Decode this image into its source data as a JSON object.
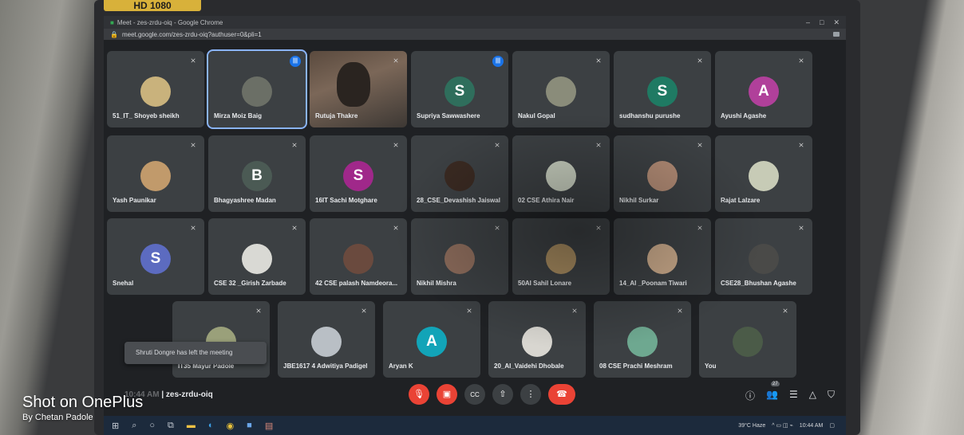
{
  "sticker": "HD 1080",
  "browser": {
    "title": "Meet - zes-zrdu-oiq - Google Chrome",
    "url": "meet.google.com/zes-zrdu-oiq?authuser=0&pli=1"
  },
  "tiles": [
    {
      "name": "51_IT_ Shoyeb sheikh",
      "avatar": "",
      "color": "#c9b27c",
      "mic": "muted"
    },
    {
      "name": "Mirza Moiz Baig",
      "avatar": "",
      "color": "#6b6f66",
      "mic": "speaking",
      "active": true
    },
    {
      "name": "Rutuja Thakre",
      "avatar": "",
      "color": "#7b6758",
      "mic": "muted",
      "video": true
    },
    {
      "name": "Supriya Sawwashere",
      "avatar": "S",
      "color": "#2f6e5c",
      "mic": "speaking"
    },
    {
      "name": "Nakul Gopal",
      "avatar": "",
      "color": "#8a8c7a",
      "mic": "muted"
    },
    {
      "name": "sudhanshu purushe",
      "avatar": "S",
      "color": "#1f7a63",
      "mic": "muted"
    },
    {
      "name": "Ayushi Agashe",
      "avatar": "A",
      "color": "#b0409a",
      "mic": "muted"
    },
    {
      "name": "Yash Paunikar",
      "avatar": "",
      "color": "#c19a6b",
      "mic": "muted"
    },
    {
      "name": "Bhagyashree Madan",
      "avatar": "B",
      "color": "#4b5a54",
      "mic": "muted"
    },
    {
      "name": "16IT Sachi Motghare",
      "avatar": "S",
      "color": "#a0288a",
      "mic": "muted"
    },
    {
      "name": "28_CSE_Devashish Jaiswal",
      "avatar": "",
      "color": "#3a2a22",
      "mic": "muted"
    },
    {
      "name": "02 CSE Athira Nair",
      "avatar": "",
      "color": "#c8cfbf",
      "mic": "muted"
    },
    {
      "name": "Nikhil Surkar",
      "avatar": "",
      "color": "#b08a74",
      "mic": "muted"
    },
    {
      "name": "Rajat Lalzare",
      "avatar": "",
      "color": "#c7cbb6",
      "mic": "muted"
    },
    {
      "name": "Snehal",
      "avatar": "S",
      "color": "#5c6bc0",
      "mic": "muted"
    },
    {
      "name": "CSE 32 _Girish Zarbade",
      "avatar": "",
      "color": "#d9d9d4",
      "mic": "muted"
    },
    {
      "name": "42 CSE palash Namdeora...",
      "avatar": "",
      "color": "#6a4a3e",
      "mic": "muted"
    },
    {
      "name": "Nikhil Mishra",
      "avatar": "",
      "color": "#8a6a5a",
      "mic": "muted"
    },
    {
      "name": "50AI Sahil Lonare",
      "avatar": "",
      "color": "#a88c60",
      "mic": "muted"
    },
    {
      "name": "14_AI _Poonam Tiwari",
      "avatar": "",
      "color": "#c9a98a",
      "mic": "muted"
    },
    {
      "name": "CSE28_Bhushan Agashe",
      "avatar": "",
      "color": "#4a4a48",
      "mic": "muted"
    },
    {
      "name": "IT35 Mayur Padole",
      "avatar": "",
      "color": "#9aa07a",
      "mic": "muted"
    },
    {
      "name": "JBE1617 4 Adwitiya Padigel",
      "avatar": "",
      "color": "#b9bfc5",
      "mic": "muted"
    },
    {
      "name": "Aryan K",
      "avatar": "A",
      "color": "#12a4b8",
      "mic": "muted"
    },
    {
      "name": "20_AI_Vaidehi Dhobale",
      "avatar": "",
      "color": "#d8d6d0",
      "mic": "muted"
    },
    {
      "name": "08 CSE Prachi Meshram",
      "avatar": "",
      "color": "#6ea890",
      "mic": "muted"
    },
    {
      "name": "You",
      "avatar": "",
      "color": "#4b5b48",
      "mic": "muted"
    }
  ],
  "toast": "Shruti Dongre has left the meeting",
  "meeting": {
    "time": "10:44 AM",
    "code": "zes-zrdu-oiq"
  },
  "controls": {
    "mic": "mic-off-icon",
    "camera": "camera-off-icon",
    "captions": "CC",
    "present": "present-icon",
    "more": "⋮",
    "end": "end-call-icon"
  },
  "right_controls": [
    "info-icon",
    "people-icon",
    "chat-icon",
    "activities-icon",
    "host-controls-icon"
  ],
  "participant_count": "27",
  "taskbar": {
    "weather": "39°C Haze",
    "time": "10:44 AM"
  },
  "watermark": {
    "line1": "Shot on OnePlus",
    "line2": "By Chetan Padole"
  }
}
